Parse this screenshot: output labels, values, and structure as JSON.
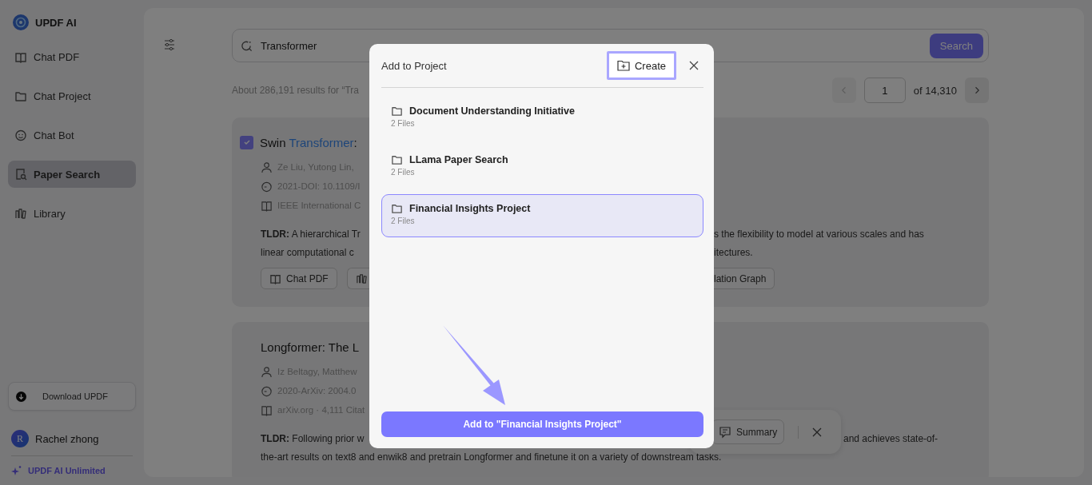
{
  "app": {
    "name": "UPDF AI"
  },
  "sidebar": {
    "items": [
      {
        "label": "Chat PDF",
        "selected": false
      },
      {
        "label": "Chat Project",
        "selected": false
      },
      {
        "label": "Chat Bot",
        "selected": false
      },
      {
        "label": "Paper Search",
        "selected": true
      },
      {
        "label": "Library",
        "selected": false
      }
    ],
    "download_button": "Download UPDF",
    "user": {
      "initial": "R",
      "name": "Rachel zhong"
    },
    "plan": "UPDF AI Unlimited"
  },
  "search": {
    "value": "Transformer",
    "button": "Search"
  },
  "results_summary": "About 286,191 results for “Tra",
  "pagination": {
    "prev": {
      "disabled": true
    },
    "page": "1",
    "total": "of 14,310",
    "next": {
      "disabled": false
    }
  },
  "results": [
    {
      "checked": true,
      "title": [
        {
          "text": "Swin ",
          "highlight": false
        },
        {
          "text": "Transformer",
          "highlight": true
        },
        {
          "text": ":",
          "highlight": false
        }
      ],
      "meta": [
        "Ze Liu,  Yutong Lin,",
        "2021-DOI: 10.1109/I",
        "IEEE International C"
      ],
      "tldr": [
        {
          "left": "**TLDR:** A hierarchical Tr",
          "right": "s the flexibility to model at various scales and has"
        },
        {
          "left": "linear computational c",
          "right": "itectures."
        }
      ],
      "actions": [
        {
          "kind": "chat",
          "label": "Chat PDF"
        },
        {
          "kind": "library"
        }
      ],
      "actions_right": [
        {
          "label": "lation Graph"
        }
      ]
    },
    {
      "title": [
        {
          "text": "Longformer: The L",
          "highlight": false
        }
      ],
      "meta": [
        "Iz Beltagy,  Matthew",
        "2020-ArXiv: 2004.0",
        "arXiv.org · 4,111 Citat"
      ],
      "tldr": [
        {
          "left": "**TLDR:** Following prior w",
          "right": "and achieves state-of-"
        },
        {
          "full": "the-art results on text8 and enwik8 and pretrain Longformer and finetune it on a variety of downstream tasks."
        }
      ]
    }
  ],
  "selection_toolbar": {
    "button": "Summary"
  },
  "modal": {
    "title": "Add to Project",
    "create": "Create",
    "projects": [
      {
        "name": "Document Understanding Initiative",
        "files": "2 Files",
        "selected": false
      },
      {
        "name": "LLama Paper Search",
        "files": "2 Files",
        "selected": false
      },
      {
        "name": "Financial Insights Project",
        "files": "2 Files",
        "selected": true
      }
    ],
    "confirm": "Add to \"Financial Insights Project\""
  }
}
